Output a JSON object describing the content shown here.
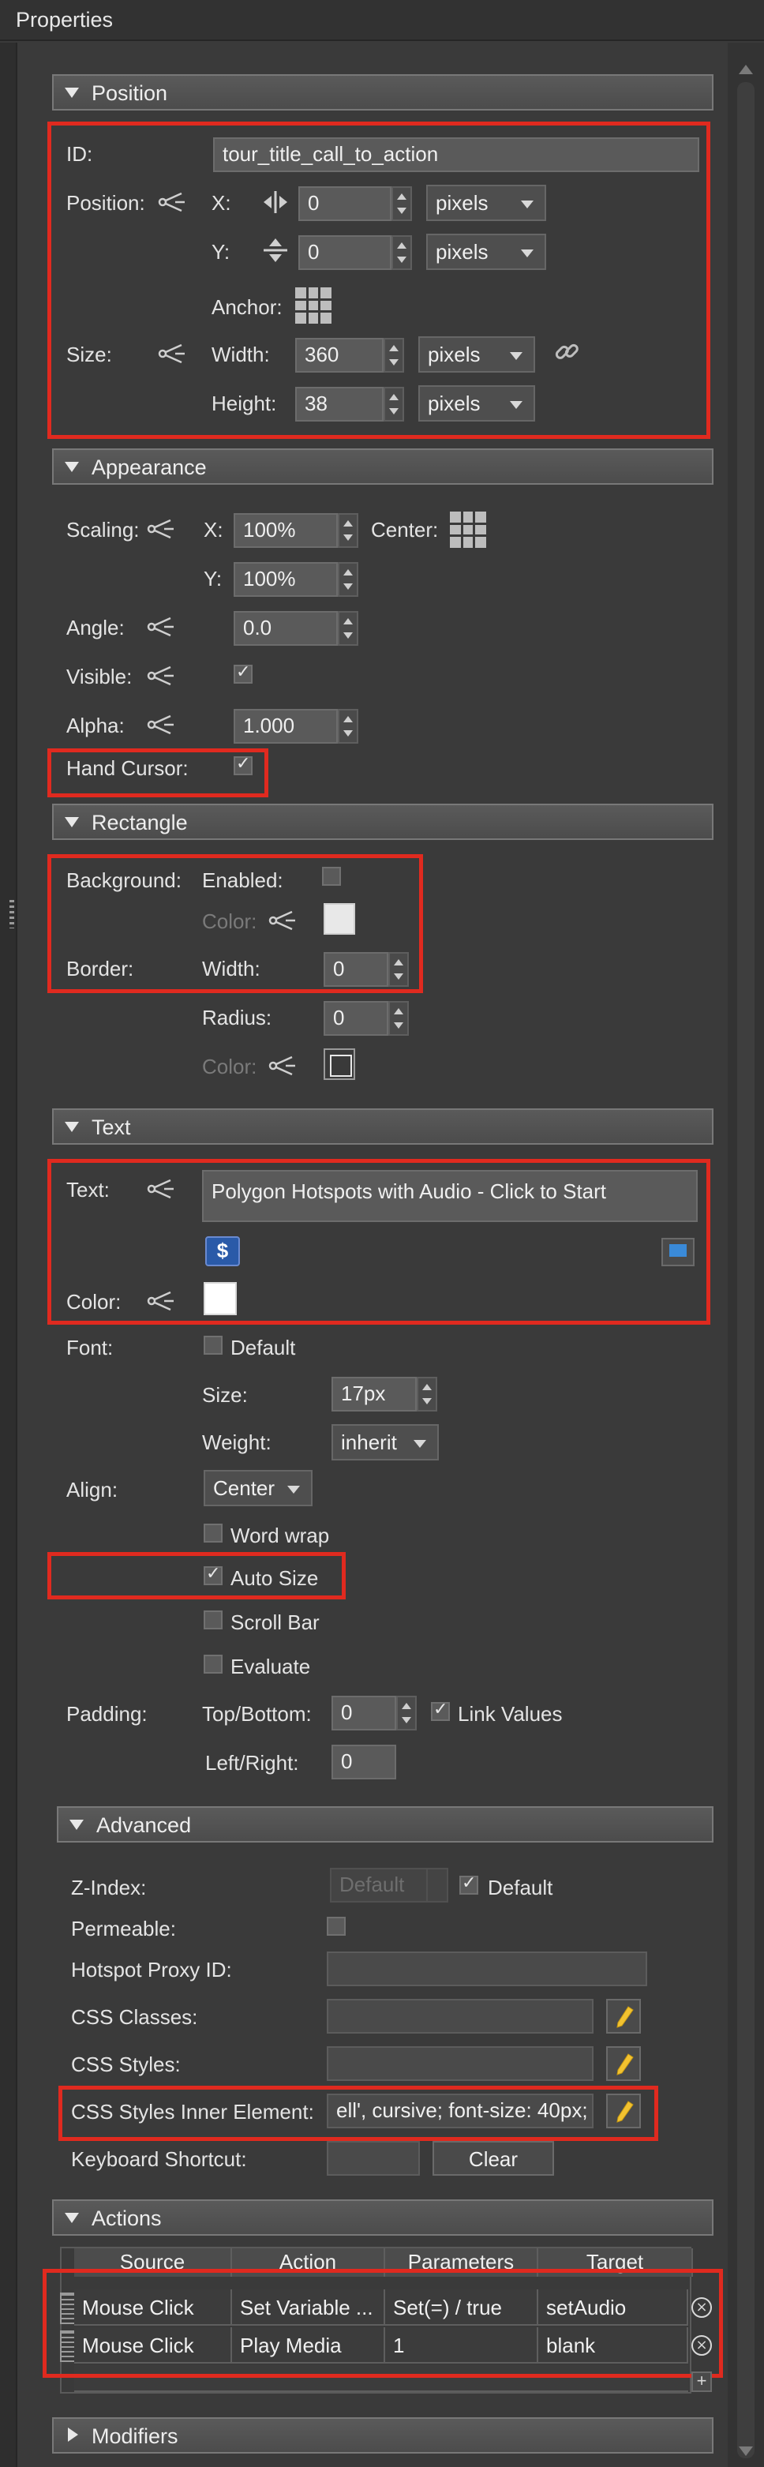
{
  "window": {
    "title": "Properties"
  },
  "sections": {
    "position": "Position",
    "appearance": "Appearance",
    "rectangle": "Rectangle",
    "text": "Text",
    "advanced": "Advanced",
    "actions": "Actions",
    "modifiers": "Modifiers"
  },
  "position": {
    "id_label": "ID:",
    "id_value": "tour_title_call_to_action",
    "position_label": "Position:",
    "x_label": "X:",
    "x_value": "0",
    "x_unit": "pixels",
    "y_label": "Y:",
    "y_value": "0",
    "y_unit": "pixels",
    "anchor_label": "Anchor:",
    "size_label": "Size:",
    "width_label": "Width:",
    "width_value": "360",
    "width_unit": "pixels",
    "height_label": "Height:",
    "height_value": "38",
    "height_unit": "pixels"
  },
  "appearance": {
    "scaling_label": "Scaling:",
    "x_label": "X:",
    "x_value": "100%",
    "center_label": "Center:",
    "y_label": "Y:",
    "y_value": "100%",
    "angle_label": "Angle:",
    "angle_value": "0.0",
    "visible_label": "Visible:",
    "alpha_label": "Alpha:",
    "alpha_value": "1.000",
    "hand_cursor_label": "Hand Cursor:"
  },
  "rectangle": {
    "background_label": "Background:",
    "enabled_label": "Enabled:",
    "color_label": "Color:",
    "border_label": "Border:",
    "width_label": "Width:",
    "width_value": "0",
    "radius_label": "Radius:",
    "radius_value": "0",
    "border_color_label": "Color:"
  },
  "text": {
    "text_label": "Text:",
    "text_value": "Polygon Hotspots with Audio - Click to Start",
    "color_label": "Color:",
    "font_label": "Font:",
    "default_label": "Default",
    "size_label": "Size:",
    "size_value": "17px",
    "weight_label": "Weight:",
    "weight_value": "inherit",
    "align_label": "Align:",
    "align_value": "Center",
    "word_wrap_label": "Word wrap",
    "auto_size_label": "Auto Size",
    "scroll_bar_label": "Scroll Bar",
    "evaluate_label": "Evaluate",
    "padding_label": "Padding:",
    "top_bottom_label": "Top/Bottom:",
    "top_bottom_value": "0",
    "link_values_label": "Link Values",
    "left_right_label": "Left/Right:",
    "left_right_value": "0"
  },
  "advanced": {
    "zindex_label": "Z-Index:",
    "zindex_value": "Default",
    "zindex_default_label": "Default",
    "permeable_label": "Permeable:",
    "proxy_label": "Hotspot Proxy ID:",
    "css_classes_label": "CSS Classes:",
    "css_styles_label": "CSS Styles:",
    "css_inner_label": "CSS Styles Inner Element:",
    "css_inner_value": "ell', cursive; font-size: 40px;",
    "keyboard_label": "Keyboard Shortcut:",
    "clear_label": "Clear"
  },
  "actions": {
    "columns": [
      "Source",
      "Action",
      "Parameters",
      "Target"
    ],
    "rows": [
      [
        "Mouse Click",
        "Set Variable ...",
        "Set(=) / true",
        "setAudio"
      ],
      [
        "Mouse Click",
        "Play Media",
        "1",
        "blank"
      ]
    ]
  }
}
